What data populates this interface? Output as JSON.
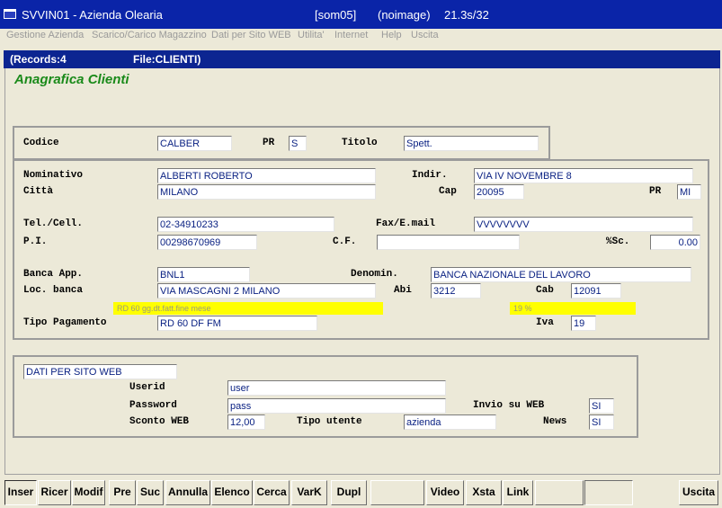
{
  "window": {
    "title": "SVVIN01 - Azienda Olearia",
    "session": "[som05]",
    "image_mode": "(noimage)",
    "version": "21.3s/32"
  },
  "menu": {
    "items": [
      "Gestione Azienda",
      "Scarico/Carico Magazzino",
      "Dati per Sito WEB",
      "Utilita'",
      "Internet",
      "Help",
      "Uscita"
    ]
  },
  "status": {
    "records": "(Records:4",
    "file": "File:CLIENTI)"
  },
  "form": {
    "title": "Anagrafica Clienti"
  },
  "header": {
    "codice_label": "Codice",
    "codice_value": "CALBER",
    "pr_label": "PR",
    "pr_value": "S",
    "titolo_label": "Titolo",
    "titolo_value": "Spett."
  },
  "details": {
    "nominativo_label": "Nominativo",
    "nominativo_value": "ALBERTI ROBERTO",
    "indir_label": "Indir.",
    "indir_value": "VIA IV NOVEMBRE 8",
    "citta_label": "Città",
    "citta_value": "MILANO",
    "cap_label": "Cap",
    "cap_value": "20095",
    "pr_label": "PR",
    "pr_value": "MI",
    "tel_label": "Tel./Cell.",
    "tel_value": "02-34910233",
    "fax_label": "Fax/E.mail",
    "fax_value": "VVVVVVVV",
    "pi_label": "P.I.",
    "pi_value": "00298670969",
    "cf_label": "C.F.",
    "cf_value": "",
    "sc_label": "%Sc.",
    "sc_value": "0.00",
    "banca_label": "Banca App.",
    "banca_value": "BNL1",
    "denomin_label": "Denomin.",
    "denomin_value": "BANCA NAZIONALE DEL LAVORO",
    "loc_label": "Loc. banca",
    "loc_value": "VIA MASCAGNI 2  MILANO",
    "abi_label": "Abi",
    "abi_value": "3212",
    "cab_label": "Cab",
    "cab_value": "12091",
    "pagamento_hint": "RD 60 gg.dt.fatt.fine mese",
    "iva_hint": "19 %",
    "pagamento_label": "Tipo Pagamento",
    "pagamento_value": "RD 60 DF FM",
    "iva_label": "Iva",
    "iva_value": "19"
  },
  "web": {
    "section_value": "DATI PER SITO WEB",
    "userid_label": "Userid",
    "userid_value": "user",
    "password_label": "Password",
    "password_value": "pass",
    "invio_label": "Invio su WEB",
    "invio_value": "SI",
    "sconto_label": "Sconto WEB",
    "sconto_value": "12,00",
    "tipo_label": "Tipo utente",
    "tipo_value": "azienda",
    "news_label": "News",
    "news_value": "SI"
  },
  "toolbar": {
    "inser": "Inser",
    "ricer": "Ricer",
    "modif": "Modif",
    "pre": "Pre",
    "suc": "Suc",
    "annulla": "Annulla",
    "elenco": "Elenco",
    "cerca": "Cerca",
    "vark": "VarK",
    "dupl": "Dupl",
    "video": "Video",
    "xsta": "Xsta",
    "link": "Link",
    "uscita": "Uscita"
  },
  "colors": {
    "title_bar": "#0a24a8",
    "status_bar": "#0c2591",
    "form_title": "#1a8a1a",
    "field_text": "#0b2283",
    "hint_bg": "#ffff00"
  }
}
